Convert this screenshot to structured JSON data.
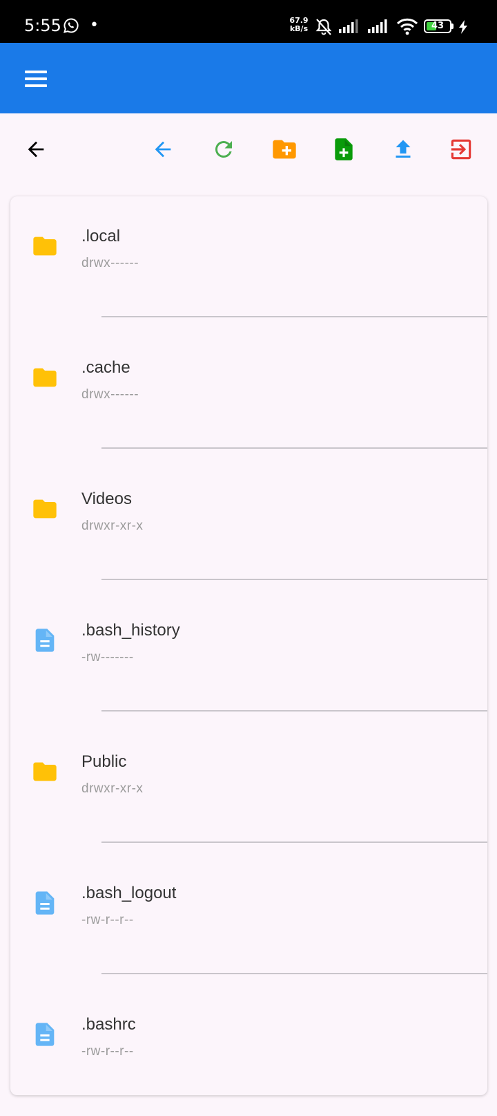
{
  "status_bar": {
    "time": "5:55",
    "dot": "•",
    "speed_value": "67.9",
    "speed_unit": "kB/s",
    "battery_level": "43",
    "icons": [
      "whatsapp-icon",
      "bell-off-icon",
      "signal-icon",
      "signal-icon",
      "wifi-icon",
      "battery-icon",
      "charging-bolt-icon"
    ]
  },
  "app_bar": {
    "menu_icon": "hamburger-menu-icon",
    "color": "#1a7ae8"
  },
  "toolbar": {
    "buttons": [
      {
        "name": "back",
        "icon": "arrow-left-icon",
        "color": "#000000"
      },
      {
        "name": "parent-directory",
        "icon": "arrow-left-icon",
        "color": "#2196f3"
      },
      {
        "name": "refresh",
        "icon": "refresh-icon",
        "color": "#4caf50"
      },
      {
        "name": "new-folder",
        "icon": "create-folder-icon",
        "color": "#ff9800"
      },
      {
        "name": "new-file",
        "icon": "note-add-icon",
        "color": "#0a9b0a"
      },
      {
        "name": "upload",
        "icon": "upload-icon",
        "color": "#2196f3"
      },
      {
        "name": "exit",
        "icon": "logout-icon",
        "color": "#e53935"
      }
    ]
  },
  "files": [
    {
      "name": ".local",
      "permissions": "drwx------",
      "type": "folder"
    },
    {
      "name": ".cache",
      "permissions": "drwx------",
      "type": "folder"
    },
    {
      "name": "Videos",
      "permissions": "drwxr-xr-x",
      "type": "folder"
    },
    {
      "name": ".bash_history",
      "permissions": "-rw-------",
      "type": "file"
    },
    {
      "name": "Public",
      "permissions": "drwxr-xr-x",
      "type": "folder"
    },
    {
      "name": ".bash_logout",
      "permissions": "-rw-r--r--",
      "type": "file"
    },
    {
      "name": ".bashrc",
      "permissions": "-rw-r--r--",
      "type": "file"
    }
  ],
  "colors": {
    "folder": "#ffc107",
    "file": "#64b5f6",
    "background": "#fcf5fb"
  }
}
